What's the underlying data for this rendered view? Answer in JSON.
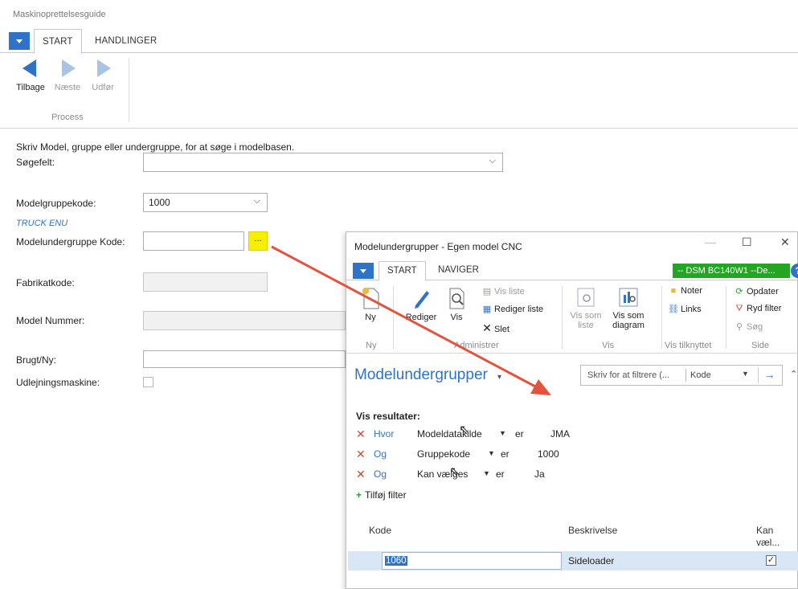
{
  "main": {
    "window_title": "Maskinoprettelsesguide",
    "tabs": [
      {
        "label": "START"
      },
      {
        "label": "HANDLINGER"
      }
    ],
    "ribbon": {
      "buttons": [
        {
          "label": "Tilbage"
        },
        {
          "label": "Næste"
        },
        {
          "label": "Udfør"
        }
      ],
      "group": "Process"
    },
    "form": {
      "hint": "Skriv Model, gruppe eller undergruppe, for at søge i modelbasen.",
      "search_label": "Søgefelt:",
      "search_value": "",
      "model_group_label": "Modelgruppekode:",
      "model_group_value": "1000",
      "group_caption": "TRUCK ENU",
      "subgroup_label": "Modelundergruppe Kode:",
      "subgroup_value": "",
      "lookup_button": "...",
      "factory_label": "Fabrikatkode:",
      "factory_value": "",
      "model_number_label": "Model Nummer:",
      "model_number_value": "",
      "used_new_label": "Brugt/Ny:",
      "used_new_value": "",
      "rental_label": "Udlejningsmaskine:",
      "rental_checked": false
    }
  },
  "popup": {
    "title": "Modelundergrupper - Egen model CNC",
    "controls": {
      "minimize": "—",
      "maximize": "☐",
      "close": "✕"
    },
    "tabs": [
      {
        "label": "START"
      },
      {
        "label": "NAVIGER"
      }
    ],
    "company": "-- DSM BC140W1 --De...",
    "help": "?",
    "ribbon": {
      "new": "Ny",
      "edit": "Rediger",
      "view": "Vis",
      "view_list": "Vis liste",
      "edit_list": "Rediger liste",
      "delete": "Slet",
      "show_as_list": "Vis som liste",
      "show_as_chart": "Vis som diagram",
      "notes": "Noter",
      "links": "Links",
      "refresh": "Opdater",
      "clear_filter": "Ryd filter",
      "search": "Søg",
      "groups": [
        "Ny",
        "Administrer",
        "Vis",
        "Vis tilknyttet",
        "Side"
      ]
    },
    "heading": "Modelundergrupper",
    "filter": {
      "placeholder": "Skriv for at filtrere (...",
      "field": "Kode"
    },
    "results_label": "Vis resultater:",
    "filters": [
      {
        "conj": "Hvor",
        "field": "Modeldatakilde",
        "op": "er",
        "value": "JMA"
      },
      {
        "conj": "Og",
        "field": "Gruppekode",
        "op": "er",
        "value": "1000"
      },
      {
        "conj": "Og",
        "field": "Kan vælges",
        "op": "er",
        "value": "Ja"
      }
    ],
    "add_filter": "Tilføj filter",
    "columns": {
      "code": "Kode",
      "description": "Beskrivelse",
      "selectable": "Kan væl..."
    },
    "rows": [
      {
        "code": "1060",
        "description": "Sideloader",
        "selectable": true
      }
    ]
  },
  "colors": {
    "accent": "#2f73c9",
    "highlight": "#f6f000",
    "company": "#24a524",
    "arrow": "#e5533c"
  }
}
